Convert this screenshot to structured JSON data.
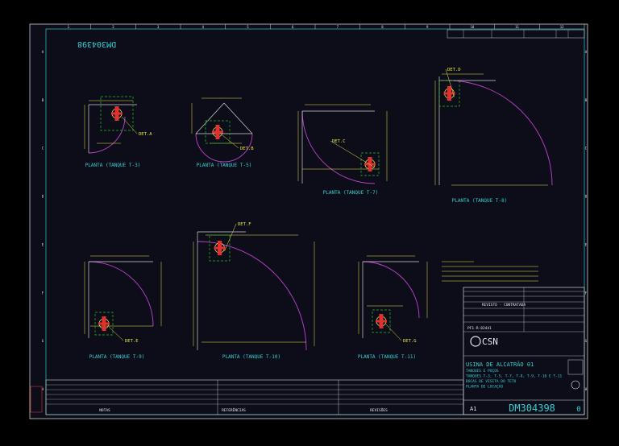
{
  "colors": {
    "background": "#000000",
    "sheet": "#0d0d1a",
    "border": "#cfcfcf",
    "frame_cyan": "#2ec8c8",
    "dim_yellow": "#e8e844",
    "arc_magenta": "#c040d0",
    "equipment_red": "#e03030",
    "detail_green": "#20c020",
    "text_cyan": "#30d0d0",
    "text_white": "#e6e6e6"
  },
  "drawing_number": "DM304398",
  "sheet_size": "A1",
  "sheet_no": "0",
  "border_numbers": [
    "1",
    "2",
    "3",
    "4",
    "5",
    "6",
    "7",
    "8",
    "9",
    "10",
    "11",
    "12"
  ],
  "border_letters": [
    "A",
    "B",
    "C",
    "D",
    "E",
    "F",
    "G",
    "H"
  ],
  "views": [
    {
      "id": "t3",
      "label": "PLANTA (TANQUE T-3)",
      "detail": "DET.A"
    },
    {
      "id": "t5",
      "label": "PLANTA (TANQUE T-5)",
      "detail": "DET.B"
    },
    {
      "id": "t7",
      "label": "PLANTA (TANQUE T-7)",
      "detail": "DET.C"
    },
    {
      "id": "t8",
      "label": "PLANTA (TANQUE T-8)",
      "detail": "DET.D"
    },
    {
      "id": "t9",
      "label": "PLANTA (TANQUE T-9)",
      "detail": "DET.E"
    },
    {
      "id": "t10",
      "label": "PLANTA (TANQUE T-10)",
      "detail": "DET.F"
    },
    {
      "id": "t11",
      "label": "PLANTA (TANQUE T-11)",
      "detail": "DET.G"
    }
  ],
  "title_block": {
    "logo": "CSN",
    "stage": "REVISTO - CONTRATADA",
    "code": "PF1-R-82441",
    "title_main": "USINA DE ALCATRÃO 01",
    "title_lines": [
      "TANQUES E POÇOS",
      "TANQUES T-3, T-5, T-7, T-8, T-9, T-10 E T-11",
      "BOCAS DE VISITA DO TETO",
      "PLANTA DE LOCAÇÃO"
    ]
  },
  "footer": {
    "notes_label": "NOTAS",
    "references_label": "REFERÊNCIAS",
    "revisions_label": "REVISÕES"
  }
}
